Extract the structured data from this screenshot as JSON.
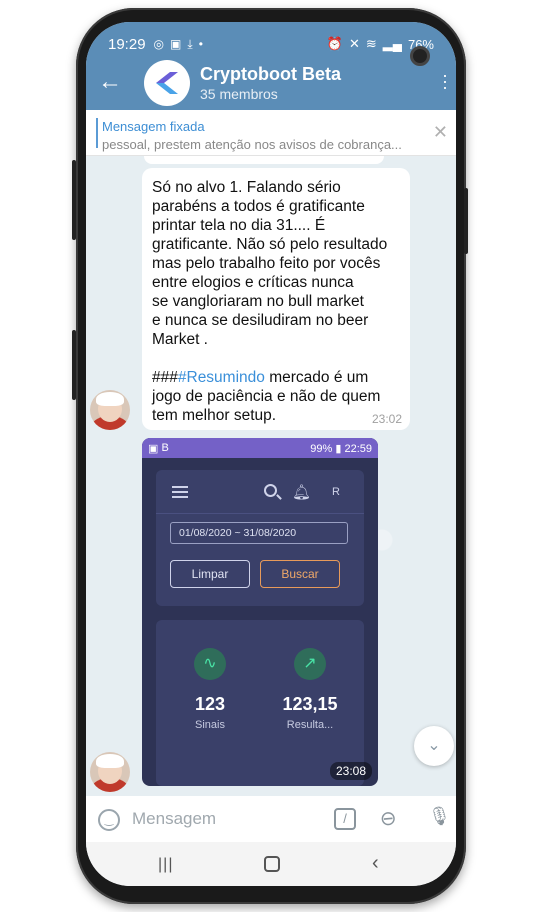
{
  "status_bar": {
    "time": "19:29",
    "battery": "76%"
  },
  "header": {
    "title": "Cryptoboot Beta",
    "subtitle": "35 membros"
  },
  "pinned": {
    "title": "Mensagem fixada",
    "text": "pessoal, prestem atenção nos avisos de cobrança..."
  },
  "message": {
    "text_before": "Só no alvo 1. Falando sério\nparabéns a todos é gratificante\nprintar tela no dia 31.... É\ngratificante.  Não só pelo resultado\nmas pelo trabalho feito por vocês\nentre elogios e críticas nunca\nse vangloriaram no bull market\ne nunca se desiludiram no beer\nMarket .\n\n###",
    "hashtag": "#Resumindo",
    "text_after": " mercado é um\njogo de paciência e não de quem\ntem melhor setup.",
    "time": "23:02"
  },
  "image_message": {
    "status_left": "B",
    "status_right": "99% ▮ 22:59",
    "menu_letter": "R",
    "date_range": "01/08/2020 ~ 31/08/2020",
    "btn_limpar": "Limpar",
    "btn_buscar": "Buscar",
    "stat1_value": "123",
    "stat1_label": "Sinais",
    "stat2_value": "123,15",
    "stat2_label": "Resulta...",
    "time": "23:08"
  },
  "input": {
    "placeholder": "Mensagem"
  },
  "colors": {
    "header": "#5b8db7",
    "accent": "#3a8fd9",
    "inner_bg": "#2e3355"
  }
}
